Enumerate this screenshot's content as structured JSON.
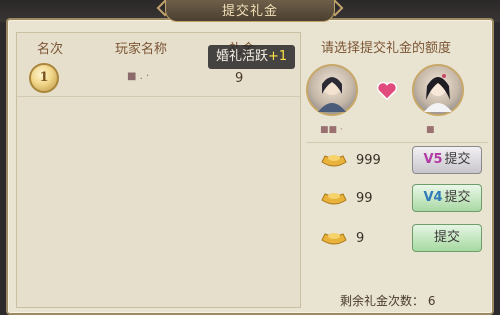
{
  "window": {
    "title": "提交礼金"
  },
  "list": {
    "headers": {
      "rank": "名次",
      "player": "玩家名称",
      "gold": "礼金"
    },
    "rows": [
      {
        "rank": "1",
        "player": "■ . ·",
        "gold": "9"
      }
    ]
  },
  "tooltip": {
    "text": "婚礼活跃",
    "plus": "+1"
  },
  "right": {
    "prompt": "请选择提交礼金的额度",
    "player1": "■■ ·",
    "player2": "■",
    "options": [
      {
        "amount": "999",
        "vip": "V5",
        "label": "提交"
      },
      {
        "amount": "99",
        "vip": "V4",
        "label": "提交"
      },
      {
        "amount": "9",
        "vip": "",
        "label": "提交"
      }
    ],
    "remaining": "剩余礼金次数： 6"
  },
  "icons": {
    "medal": "rank-medal-icon",
    "heart": "heart-icon",
    "ingot": "gold-ingot-icon"
  },
  "colors": {
    "header_text": "#7c5534",
    "panel_bg": "#e9e3d1",
    "vip5": "#b13aa6",
    "vip4": "#2f7ab8",
    "heart": "#e14a7d"
  }
}
